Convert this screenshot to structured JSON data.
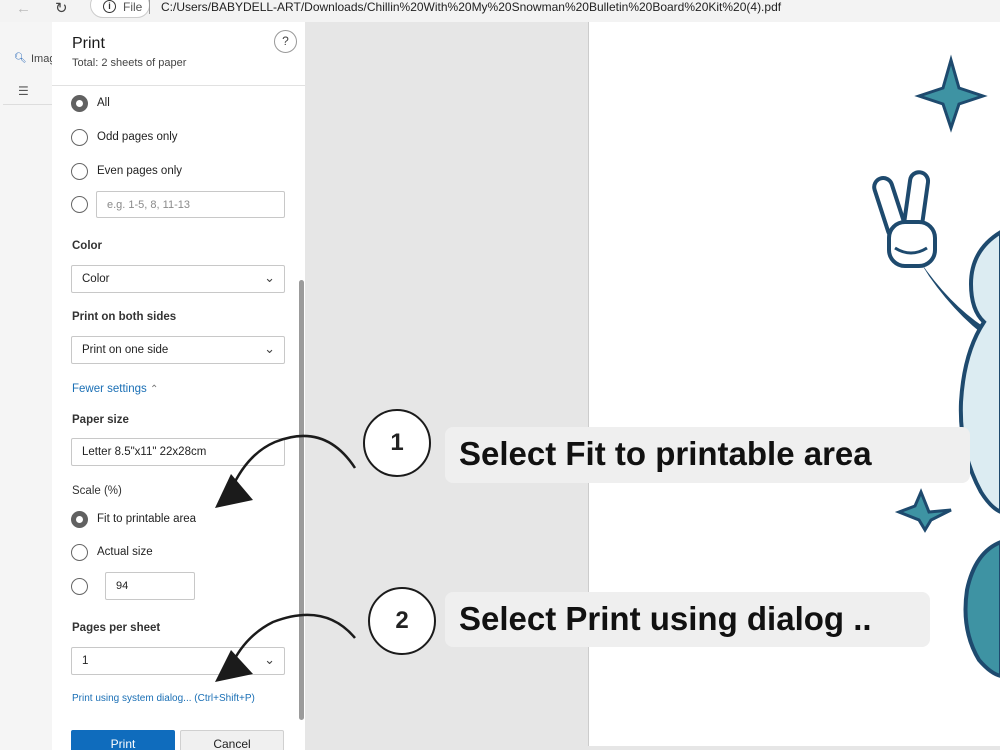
{
  "browser": {
    "file_label": "File",
    "url": "C:/Users/BABYDELL-ART/Downloads/Chillin%20With%20My%20Snowman%20Bulletin%20Board%20Kit%20(4).pdf"
  },
  "behind": {
    "search_fragment": "Imag"
  },
  "dialog": {
    "title": "Print",
    "subtitle": "Total: 2 sheets of paper",
    "help_label": "?",
    "pages": {
      "options": [
        "All",
        "Odd pages only",
        "Even pages only"
      ],
      "custom_placeholder": "e.g. 1-5, 8, 11-13",
      "selected": "All"
    },
    "color": {
      "label": "Color",
      "value": "Color"
    },
    "duplex": {
      "label": "Print on both sides",
      "value": "Print on one side"
    },
    "fewer_settings": "Fewer settings",
    "paper_size": {
      "label": "Paper size",
      "value": "Letter 8.5\"x11\" 22x28cm"
    },
    "scale": {
      "label": "Scale (%)",
      "options": [
        "Fit to printable area",
        "Actual size"
      ],
      "custom_value": "94",
      "selected": "Fit to printable area"
    },
    "pages_per_sheet": {
      "label": "Pages per sheet",
      "value": "1"
    },
    "system_dialog_link": "Print using system dialog... (Ctrl+Shift+P)",
    "print_button": "Print",
    "cancel_button": "Cancel"
  },
  "annotations": [
    {
      "number": "1",
      "text": "Select Fit to printable area"
    },
    {
      "number": "2",
      "text": "Select Print using dialog .."
    }
  ],
  "colors": {
    "accent_blue": "#0f6cbd",
    "link_blue": "#1a6fb5",
    "snowman_teal": "#3e93a3",
    "snowman_navy": "#1e4a6e",
    "snowman_light": "#dcecf2"
  },
  "icons": [
    "back-arrow-icon",
    "reload-icon",
    "info-icon",
    "search-icon",
    "list-icon",
    "chevron-down-icon",
    "chevron-up-icon",
    "help-icon"
  ]
}
